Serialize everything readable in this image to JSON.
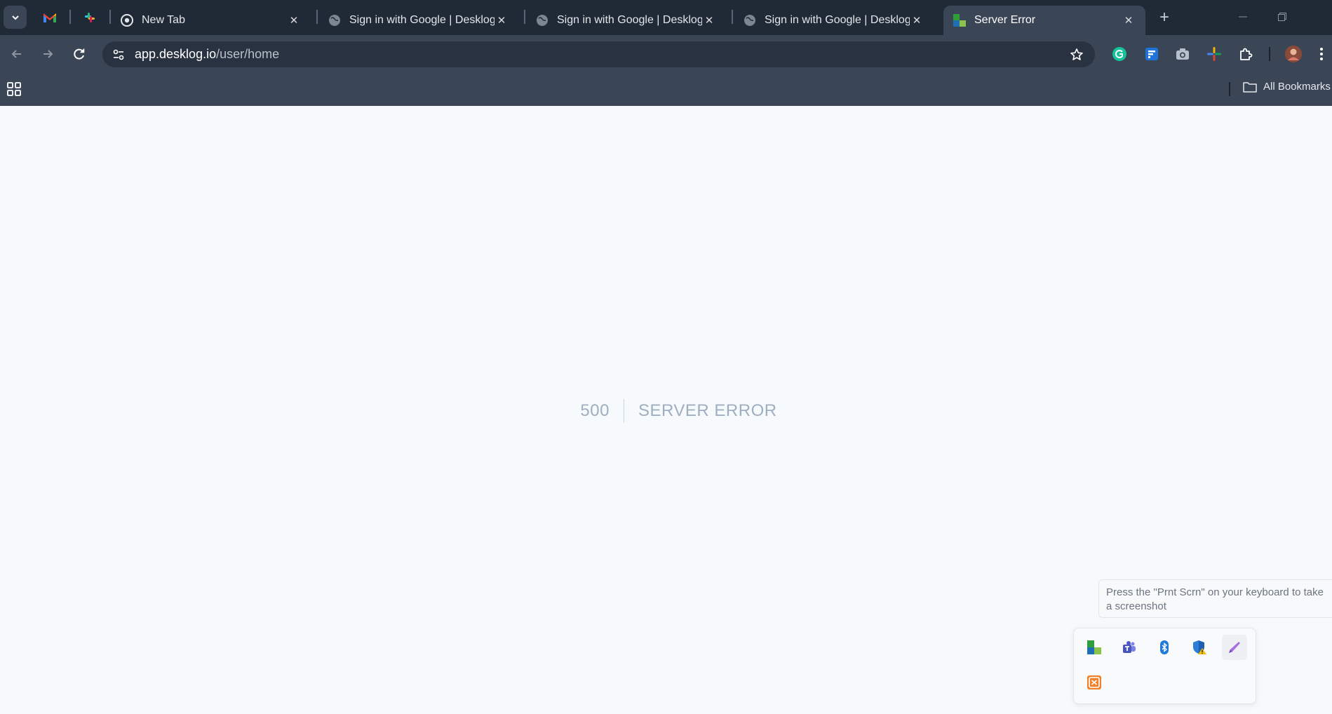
{
  "tabs": [
    {
      "title": "New Tab",
      "favicon": "chrome-icon"
    },
    {
      "title": "Sign in with Google | Desklog",
      "favicon": "globe-icon"
    },
    {
      "title": "Sign in with Google | Desklog",
      "favicon": "globe-icon"
    },
    {
      "title": "Sign in with Google | Desklog",
      "favicon": "globe-icon"
    },
    {
      "title": "Server Error",
      "favicon": "desklog-icon",
      "active": true
    }
  ],
  "pinned_tabs": [
    "gmail-icon",
    "slack-icon"
  ],
  "address_bar": {
    "host": "app.desklog.io",
    "path": "/user/home"
  },
  "bookmarks": {
    "all_label": "All Bookmarks"
  },
  "page": {
    "code": "500",
    "message": "SERVER ERROR"
  },
  "tooltip": {
    "text": "Press the \"Prnt Scrn\" on your keyboard to take a screenshot"
  },
  "tray_icons": [
    "desklog-tray-icon",
    "teams-icon",
    "bluetooth-icon",
    "defender-warning-icon",
    "pen-icon",
    "xampp-icon"
  ],
  "colors": {
    "tabstrip": "#202a36",
    "toolbar": "#3a4556",
    "page_bg": "#f7fafc",
    "error_text": "#a0aec0"
  }
}
